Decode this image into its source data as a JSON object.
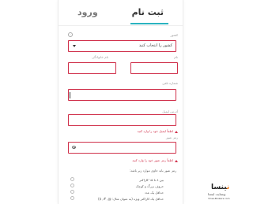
{
  "tabs": {
    "signup": "ثبت نام",
    "login": "ورود"
  },
  "form": {
    "country_label": "کشور",
    "country_value": "کشور را انتخاب کنید",
    "first_name_label": "نام",
    "last_name_label": "نام خانوادگی",
    "phone_label": "شماره تلفن",
    "email_label": "آدرس ایمیل",
    "email_error": "لطفاً ایمیل خود را وارد کنید",
    "password_label": "رمز عبور",
    "password_error": "لطفاً رمز عبور خود را وارد کنید"
  },
  "requirements": {
    "title": "رمز عبور باید حاوی موارد زیر باشد:",
    "items": [
      "بین ۸ تا ۱۵ کاراکتر",
      "حروف بزرگ و کوچک",
      "حداقل یک عدد",
      "حداقل یک کاراکتر ویژه (به عنوان مثال: @, #, $)"
    ]
  },
  "watermark": {
    "text_brand": "ینسا",
    "text_accent": "ن",
    "subtitle": "وبسایت اینسا",
    "url": "Yinsa-Brokers.com"
  }
}
